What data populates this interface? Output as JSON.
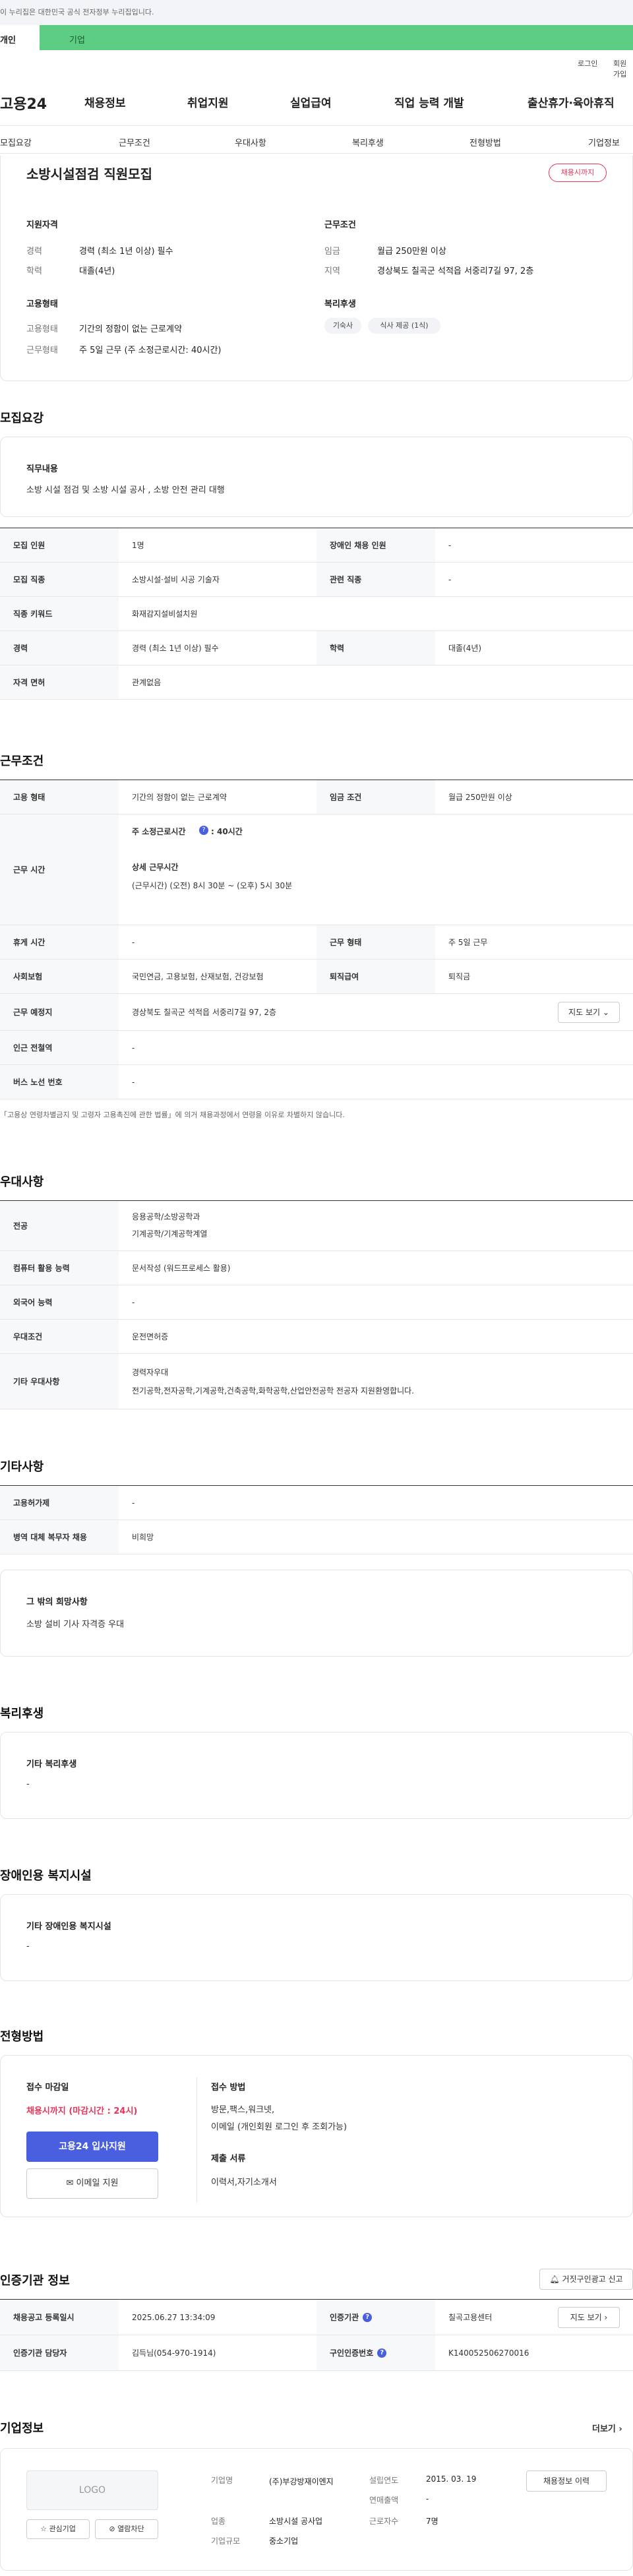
{
  "gov_notice": "이 누리집은 대한민국 공식 전자정부 누리집입니다.",
  "tabs": {
    "individual": "개인",
    "company": "기업"
  },
  "util": {
    "login": "로그인",
    "join": "회원가입"
  },
  "logo": "고용24",
  "gnb": [
    "채용정보",
    "취업지원",
    "실업급여",
    "직업 능력 개발",
    "출산휴가·육아휴직"
  ],
  "subnav": [
    "모집요강",
    "근무조건",
    "우대사항",
    "복리후생",
    "전형방법",
    "기업정보"
  ],
  "job": {
    "title": "소방시설점검 직원모집",
    "badge": "채용시까지"
  },
  "summary": {
    "qual_title": "지원자격",
    "career_k": "경력",
    "career_v": "경력 (최소 1년 이상) 필수",
    "edu_k": "학력",
    "edu_v": "대졸(4년)",
    "cond_title": "근무조건",
    "wage_k": "임금",
    "wage_v": "월급 250만원 이상",
    "area_k": "지역",
    "area_v": "경상북도 칠곡군 석적읍 서중리7길 97, 2층",
    "emp_title": "고용형태",
    "emp_type_k": "고용형태",
    "emp_type_v": "기간의 정함이 없는 근로계약",
    "emp_hours_k": "근무형태",
    "emp_hours_v": "주 5일 근무 (주 소정근로시간: 40시간)",
    "welfare_title": "복리후생",
    "chips": [
      "기숙사",
      "식사 제공 (1식)"
    ]
  },
  "recruit": {
    "section": "모집요강",
    "duty_title": "직무내용",
    "duty_text": "소방 시설 점검 및 소방 시설 공사 , 소방 안전 관리 대행",
    "rows": [
      {
        "k1": "모집 인원",
        "v1": "1명",
        "k2": "장애인 채용 인원",
        "v2": "-"
      },
      {
        "k1": "모집 직종",
        "v1": "소방시설·설비 시공 기술자",
        "k2": "관련 직종",
        "v2": "-"
      },
      {
        "k1": "직종 키워드",
        "v1": "화재감지설비설치원"
      },
      {
        "k1": "경력",
        "v1": "경력 (최소 1년 이상) 필수",
        "k2": "학력",
        "v2": "대졸(4년)"
      },
      {
        "k1": "자격 면허",
        "v1": "관계없음"
      }
    ]
  },
  "work": {
    "section": "근무조건",
    "emp_k": "고용 형태",
    "emp_v": "기간의 정함이 없는 근로계약",
    "wage_k": "임금 조건",
    "wage_v": "월급 250만원 이상",
    "time_k": "근무 시간",
    "time_std": "주 소정근로시간",
    "time_std_v": ": 40시간",
    "time_detail_title": "상세 근무시간",
    "time_detail": "(근무시간) (오전) 8시 30분 ~ (오후) 5시 30분",
    "rest_k": "휴게 시간",
    "rest_v": "-",
    "form_k": "근무 형태",
    "form_v": "주 5일 근무",
    "ins_k": "사회보험",
    "ins_v": "국민연금, 고용보험, 산재보험, 건강보험",
    "ret_k": "퇴직급여",
    "ret_v": "퇴직금",
    "place_k": "근무 예정지",
    "place_v": "경상북도 칠곡군 석적읍 서중리7길 97, 2층",
    "map_btn": "지도 보기",
    "station_k": "인근 전철역",
    "station_v": "-",
    "bus_k": "버스 노선 번호",
    "bus_v": "-",
    "note": "「고용상 연령차별금지 및 고령자 고용촉진에 관한 법률」에 의거 채용과정에서 연령을 이유로 차별하지 않습니다."
  },
  "pref": {
    "section": "우대사항",
    "major_k": "전공",
    "major_v1": "응용공학/소방공학과",
    "major_v2": "기계공학/기계공학계열",
    "pc_k": "컴퓨터 활용 능력",
    "pc_v": "문서작성 (워드프로세스 활용)",
    "lang_k": "외국어 능력",
    "lang_v": "-",
    "cond_k": "우대조건",
    "cond_v": "운전면허증",
    "etc_k": "기타 우대사항",
    "etc_v1": "경력자우대",
    "etc_v2": "전기공학,전자공학,기계공학,건축공학,화학공학,산업안전공학 전공자 지원환영합니다."
  },
  "etc": {
    "section": "기타사항",
    "permit_k": "고용허가제",
    "permit_v": "-",
    "mil_k": "병역 대체 복무자 채용",
    "mil_v": "비희망",
    "wish_title": "그 밖의 희망사항",
    "wish_text": "소방 설비 기사 자격증 우대"
  },
  "welfare": {
    "section": "복리후생",
    "title": "기타 복리후생",
    "text": "-"
  },
  "disabled": {
    "section": "장애인용 복지시설",
    "title": "기타 장애인용 복지시설",
    "text": "-"
  },
  "process": {
    "section": "전형방법",
    "deadline_title": "접수 마감일",
    "deadline": "채용시까지 (마감시간 : 24시)",
    "apply_btn": "고용24 입사지원",
    "email_btn": "이메일 지원",
    "method_title": "접수 방법",
    "method_v1": "방문,팩스,워크넷,",
    "method_v2": "이메일 (개인회원 로그인 후 조회가능)",
    "docs_title": "제출 서류",
    "docs_v": "이력서,자기소개서"
  },
  "cert": {
    "section": "인증기관 정보",
    "report_btn": "거짓구인광고 신고",
    "reg_k": "채용공고 등록일시",
    "reg_v": "2025.06.27 13:34:09",
    "org_k": "인증기관",
    "org_v": "칠곡고용센터",
    "map_btn": "지도 보기",
    "mgr_k": "인증기관 담당자",
    "mgr_v": "김득님(054-970-1914)",
    "no_k": "구인인증번호",
    "no_v": "K140052506270016"
  },
  "company": {
    "section": "기업정보",
    "more": "더보기",
    "logo": "LOGO",
    "fav_btn": "관심기업",
    "block_btn": "열람차단",
    "name_k": "기업명",
    "name_v": "(주)부강방재이엔지",
    "ind_k": "업종",
    "ind_v": "소방시설 공사업",
    "size_k": "기업규모",
    "size_v": "중소기업",
    "est_k": "설립연도",
    "est_v": "2015. 03. 19",
    "sales_k": "연매출액",
    "sales_v": "-",
    "emp_k": "근로자수",
    "emp_v": "7명",
    "jobs_btn": "채용정보 이력"
  }
}
